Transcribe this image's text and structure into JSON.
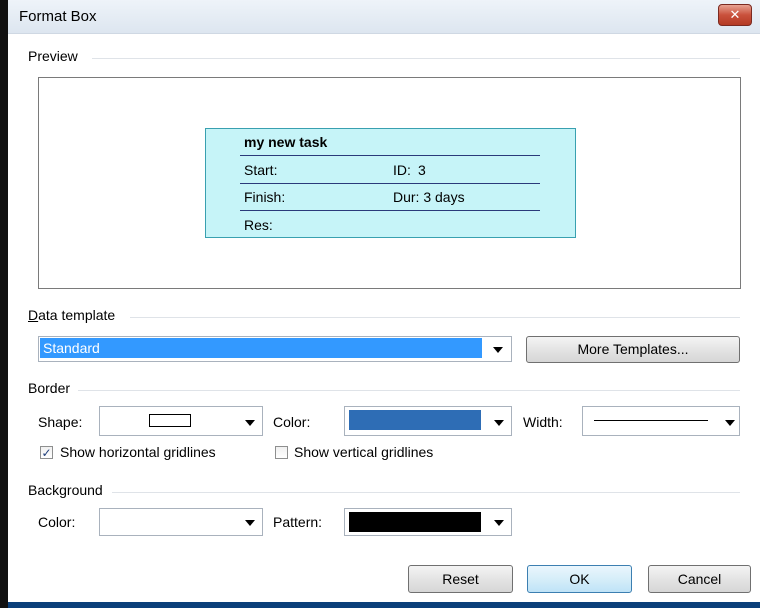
{
  "window": {
    "title": "Format Box",
    "close_symbol": "✕"
  },
  "preview": {
    "group_label": "Preview",
    "card": {
      "task_name": "my new task",
      "start_label": "Start:",
      "id_label": "ID:",
      "id_value": "3",
      "finish_label": "Finish:",
      "duration_text": "Dur: 3 days",
      "resources_label": "Res:",
      "fill_color": "#c6f4f8",
      "border_color": "#39a0b0"
    }
  },
  "data_template": {
    "group_label": "Data template",
    "selected": "Standard",
    "more_button": "More Templates..."
  },
  "border": {
    "group_label": "Border",
    "shape_label": "Shape:",
    "color_label": "Color:",
    "color_value": "#2e6db5",
    "width_label": "Width:",
    "show_horizontal_gridlines": "Show horizontal gridlines",
    "horizontal_checked": true,
    "show_vertical_gridlines": "Show vertical gridlines",
    "vertical_checked": false
  },
  "background": {
    "group_label": "Background",
    "color_label": "Color:",
    "color_value": "#ffffff",
    "pattern_label": "Pattern:",
    "pattern_value": "#000000"
  },
  "buttons": {
    "reset": "Reset",
    "ok": "OK",
    "cancel": "Cancel"
  }
}
